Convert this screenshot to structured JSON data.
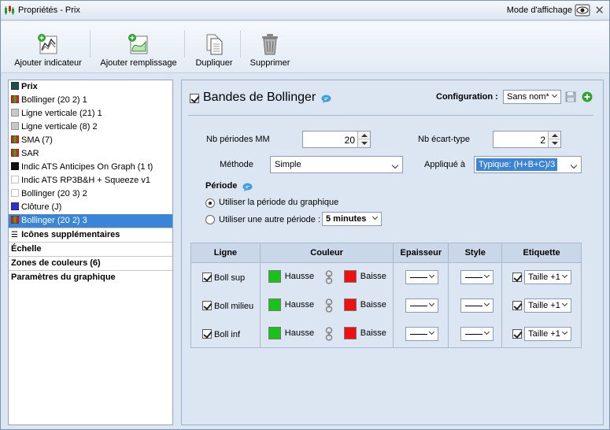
{
  "window": {
    "title": "Propriétés - Prix",
    "mode_label": "Mode d'affichage"
  },
  "toolbar": {
    "add_indicator": "Ajouter indicateur",
    "add_fill": "Ajouter remplissage",
    "duplicate": "Dupliquer",
    "delete": "Supprimer"
  },
  "sidebar": {
    "items": [
      {
        "label": "Prix",
        "swatch": "#1e4d4a",
        "bold": true
      },
      {
        "label": "Bollinger (20 2) 1",
        "swatch": "split"
      },
      {
        "label": "Ligne verticale (21) 1",
        "swatch": "#c8c8c8"
      },
      {
        "label": "Ligne verticale (8) 2",
        "swatch": "#c8c8c8"
      },
      {
        "label": "SMA (7)",
        "swatch": "split"
      },
      {
        "label": "SAR",
        "swatch": "split"
      },
      {
        "label": "Indic ATS Anticipes On Graph (1 t)",
        "swatch": "#111111"
      },
      {
        "label": "Indic ATS RP3B&H + Squeeze v1",
        "swatch": "#ffffff"
      },
      {
        "label": "Bollinger (20 3) 2",
        "swatch": "#ffffff"
      },
      {
        "label": "Clôture (J)",
        "swatch": "#3030c8"
      },
      {
        "label": "Bollinger (20 2) 3",
        "swatch": "split",
        "selected": true
      }
    ],
    "sections": [
      "Icônes supplémentaires",
      "Échelle",
      "Zones de couleurs (6)",
      "Paramètres du graphique"
    ]
  },
  "panel": {
    "title": "Bandes de Bollinger",
    "config_label": "Configuration :",
    "config_value": "Sans nom*",
    "nb_periodes_label": "Nb périodes MM",
    "nb_periodes_value": "20",
    "nb_ecart_label": "Nb écart-type",
    "nb_ecart_value": "2",
    "methode_label": "Méthode",
    "methode_value": "Simple",
    "applique_label": "Appliqué à",
    "applique_value": "Typique: (H+B+C)/3",
    "periode_label": "Période",
    "radio_graph": "Utiliser la période du graphique",
    "radio_other": "Utiliser une autre période :",
    "other_period_value": "5 minutes"
  },
  "table": {
    "headers": [
      "Ligne",
      "Couleur",
      "Epaisseur",
      "Style",
      "Etiquette"
    ],
    "rows": [
      {
        "name": "Boll sup",
        "up": "Hausse",
        "down": "Baisse",
        "label": "Taille +1"
      },
      {
        "name": "Boll milieu",
        "up": "Hausse",
        "down": "Baisse",
        "label": "Taille +1"
      },
      {
        "name": "Boll inf",
        "up": "Hausse",
        "down": "Baisse",
        "label": "Taille +1"
      }
    ]
  },
  "colors": {
    "up": "#19c219",
    "down": "#ee1111",
    "selection": "#3b85d8",
    "split_a": "#e02020",
    "split_b": "#20b020"
  }
}
